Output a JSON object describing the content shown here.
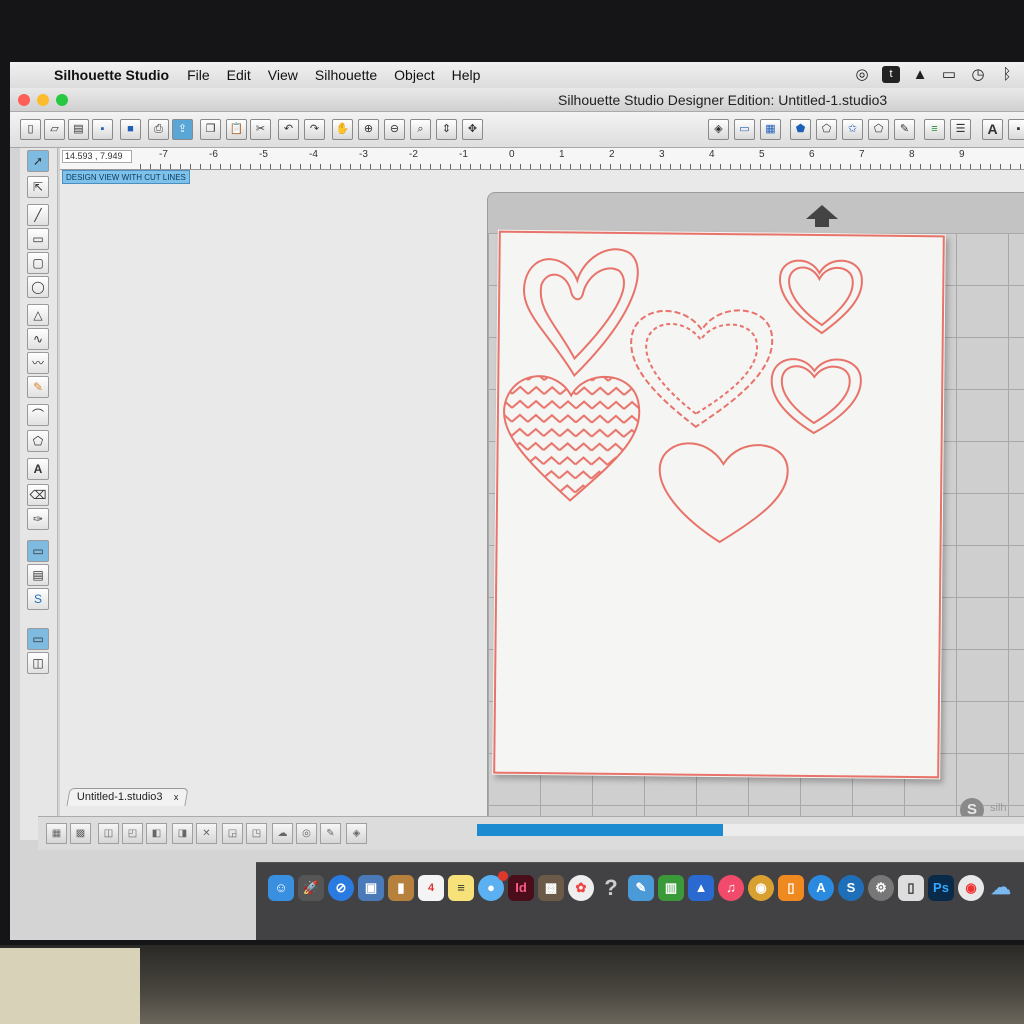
{
  "menubar": {
    "app_name": "Silhouette Studio",
    "items": [
      "File",
      "Edit",
      "View",
      "Silhouette",
      "Object",
      "Help"
    ]
  },
  "window": {
    "title": "Silhouette Studio Designer Edition: Untitled-1.studio3"
  },
  "ruler": {
    "coordinates": "14.593 , 7.949",
    "labels": [
      "-7",
      "-6",
      "-5",
      "-4",
      "-3",
      "-2",
      "-1",
      "0",
      "1",
      "2",
      "3",
      "4",
      "5",
      "6",
      "7",
      "8",
      "9"
    ]
  },
  "view_mode_label": "DESIGN VIEW WITH CUT LINES",
  "document_tab": {
    "name": "Untitled-1.studio3",
    "close": "x"
  },
  "progress_fraction": 0.45,
  "colors": {
    "cut_line": "#e8736a",
    "selection_blue": "#5aa6d6",
    "progress_blue": "#1d8bd0"
  },
  "icons": {
    "apple": "",
    "close_tab": "x"
  },
  "dock": {
    "calendar_day": "4"
  }
}
